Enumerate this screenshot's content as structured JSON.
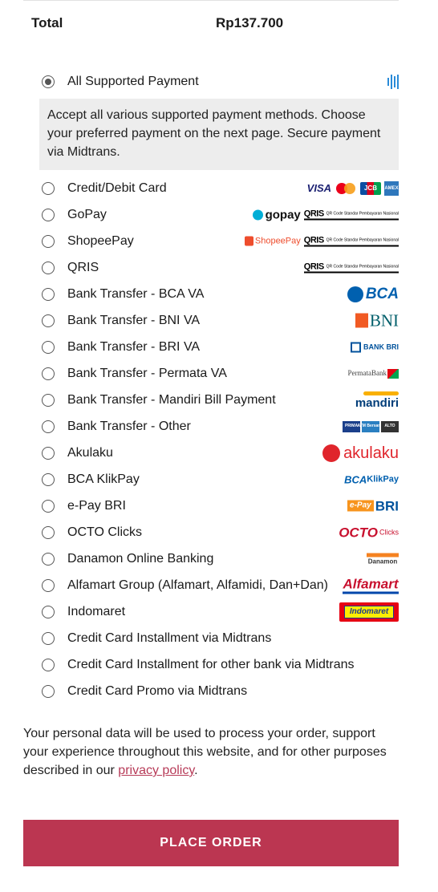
{
  "totals": {
    "label": "Total",
    "value": "Rp137.700"
  },
  "payment": {
    "selected": "All Supported Payment",
    "all_label": "All Supported Payment",
    "description": "Accept all various supported payment methods. Choose your preferred payment on the next page. Secure payment via Midtrans.",
    "methods": [
      {
        "label": "Credit/Debit Card",
        "logos": [
          "visa-logo",
          "mastercard-logo",
          "jcb-logo",
          "amex-logo"
        ]
      },
      {
        "label": "GoPay",
        "logos": [
          "gopay-logo",
          "qris-logo"
        ]
      },
      {
        "label": "ShopeePay",
        "logos": [
          "shopeepay-logo",
          "qris-logo"
        ]
      },
      {
        "label": "QRIS",
        "logos": [
          "qris-logo"
        ]
      },
      {
        "label": "Bank Transfer - BCA VA",
        "logos": [
          "bca-logo"
        ]
      },
      {
        "label": "Bank Transfer - BNI VA",
        "logos": [
          "bni-logo"
        ]
      },
      {
        "label": "Bank Transfer - BRI VA",
        "logos": [
          "bri-logo"
        ]
      },
      {
        "label": "Bank Transfer - Permata VA",
        "logos": [
          "permata-logo"
        ]
      },
      {
        "label": "Bank Transfer - Mandiri Bill Payment",
        "logos": [
          "mandiri-logo"
        ]
      },
      {
        "label": "Bank Transfer - Other",
        "logos": [
          "atm-network-logos"
        ]
      },
      {
        "label": "Akulaku",
        "logos": [
          "akulaku-logo"
        ]
      },
      {
        "label": "BCA KlikPay",
        "logos": [
          "bca-klikpay-logo"
        ]
      },
      {
        "label": "e-Pay BRI",
        "logos": [
          "epay-bri-logo"
        ]
      },
      {
        "label": "OCTO Clicks",
        "logos": [
          "octo-clicks-logo"
        ]
      },
      {
        "label": "Danamon Online Banking",
        "logos": [
          "danamon-logo"
        ]
      },
      {
        "label": "Alfamart Group (Alfamart, Alfamidi, Dan+Dan)",
        "logos": [
          "alfamart-logo"
        ]
      },
      {
        "label": "Indomaret",
        "logos": [
          "indomaret-logo"
        ]
      },
      {
        "label": "Credit Card Installment via Midtrans",
        "logos": []
      },
      {
        "label": "Credit Card Installment for other bank via Midtrans",
        "logos": []
      },
      {
        "label": "Credit Card Promo via Midtrans",
        "logos": []
      }
    ]
  },
  "logo_text": {
    "visa": "VISA",
    "jcb": "JCB",
    "amex": "AMEX",
    "qris": "QRIS",
    "qris_small": "QR Code Standar Pembayaran Nasional",
    "gopay": "gopay",
    "shopeepay": "ShopeePay",
    "bca": "BCA",
    "bni": "BNI",
    "bri": "BANK BRI",
    "permata": "PermataBank",
    "mandiri": "mandiri",
    "prima": "PRIMA",
    "atm_bersama": "ATM Bersama",
    "alto": "ALTO",
    "akulaku": "akulaku",
    "klikpay_bca": "BCA",
    "klikpay": "KlikPay",
    "epay": "e-Pay",
    "epay_bri": "BRI",
    "octo": "OCTO",
    "octo_clicks": "Clicks",
    "danamon": "Danamon",
    "alfamart": "Alfamart",
    "indomaret": "Indomaret"
  },
  "privacy": {
    "text": "Your personal data will be used to process your order, support your experience throughout this website, and for other purposes described in our ",
    "link": "privacy policy",
    "suffix": "."
  },
  "place_order": "PLACE ORDER",
  "colors": {
    "accent": "#bb3651",
    "link": "#b73b58",
    "desc_bg": "#ededed"
  }
}
